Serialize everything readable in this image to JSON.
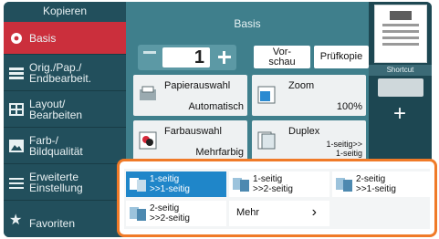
{
  "sidebar": {
    "title": "Kopieren",
    "items": [
      {
        "label": "Basis",
        "icon": "gear-icon",
        "active": true
      },
      {
        "label": "Orig./Pap./\nEndbearbeit.",
        "icon": "document-settings-icon"
      },
      {
        "label": "Layout/\nBearbeiten",
        "icon": "layout-icon"
      },
      {
        "label": "Farb-/\nBildqualität",
        "icon": "image-quality-icon"
      },
      {
        "label": "Erweiterte\nEinstellung",
        "icon": "advanced-settings-icon"
      },
      {
        "label": "Favoriten",
        "icon": "star-icon"
      }
    ]
  },
  "main": {
    "title": "Basis",
    "copies": "1",
    "preview_label": "Vor-\nschau",
    "proof_label": "Prüfkopie",
    "tiles": {
      "papier": {
        "title": "Papierauswahl",
        "value": "Automatisch"
      },
      "zoom": {
        "title": "Zoom",
        "value": "100%"
      },
      "farb": {
        "title": "Farbauswahl",
        "value": "Mehrfarbig"
      },
      "duplex": {
        "title": "Duplex",
        "value": "1-seitig>>\n1-seitig"
      }
    }
  },
  "right": {
    "shortcut_label": "Shortcut"
  },
  "popup": {
    "options": [
      {
        "label": "1-seitig\n>>1-seitig",
        "selected": true
      },
      {
        "label": "1-seitig\n>>2-seitig",
        "selected": false
      },
      {
        "label": "2-seitig\n>>1-seitig",
        "selected": false
      },
      {
        "label": "2-seitig\n>>2-seitig",
        "selected": false
      }
    ],
    "more_label": "Mehr",
    "more_arrow": "›"
  },
  "colors": {
    "accent": "#f07a28",
    "selected": "#1f86c9",
    "active": "#cb2f3c"
  }
}
